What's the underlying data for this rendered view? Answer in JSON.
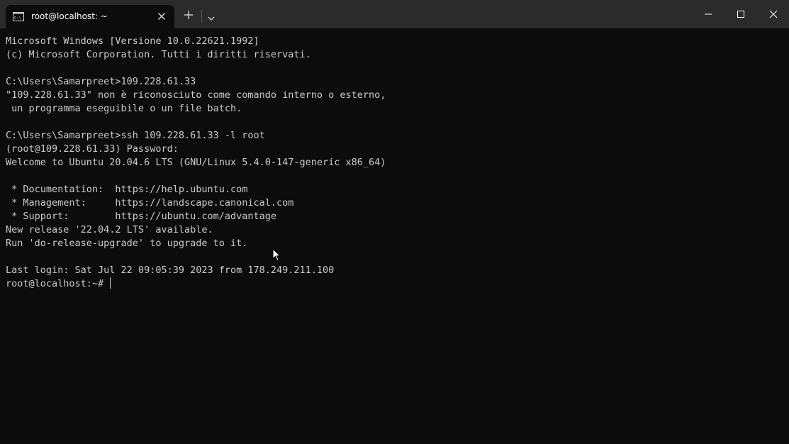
{
  "tab": {
    "title": "root@localhost: ~",
    "icon": "terminal-icon"
  },
  "titlebar": {
    "new_tab_icon": "plus-icon",
    "dropdown_icon": "chevron-down-icon",
    "minimize_icon": "minimize-icon",
    "maximize_icon": "maximize-icon",
    "close_icon": "close-icon"
  },
  "terminal": {
    "lines": [
      "Microsoft Windows [Versione 10.0.22621.1992]",
      "(c) Microsoft Corporation. Tutti i diritti riservati.",
      "",
      "C:\\Users\\Samarpreet>109.228.61.33",
      "\"109.228.61.33\" non è riconosciuto come comando interno o esterno,",
      " un programma eseguibile o un file batch.",
      "",
      "C:\\Users\\Samarpreet>ssh 109.228.61.33 -l root",
      "(root@109.228.61.33) Password:",
      "Welcome to Ubuntu 20.04.6 LTS (GNU/Linux 5.4.0-147-generic x86_64)",
      "",
      " * Documentation:  https://help.ubuntu.com",
      " * Management:     https://landscape.canonical.com",
      " * Support:        https://ubuntu.com/advantage",
      "New release '22.04.2 LTS' available.",
      "Run 'do-release-upgrade' to upgrade to it.",
      "",
      "Last login: Sat Jul 22 09:05:39 2023 from 178.249.211.100"
    ],
    "prompt": "root@localhost:~# "
  },
  "colors": {
    "background": "#0c0c0c",
    "titlebar": "#2b2b2b",
    "text": "#cccccc"
  }
}
